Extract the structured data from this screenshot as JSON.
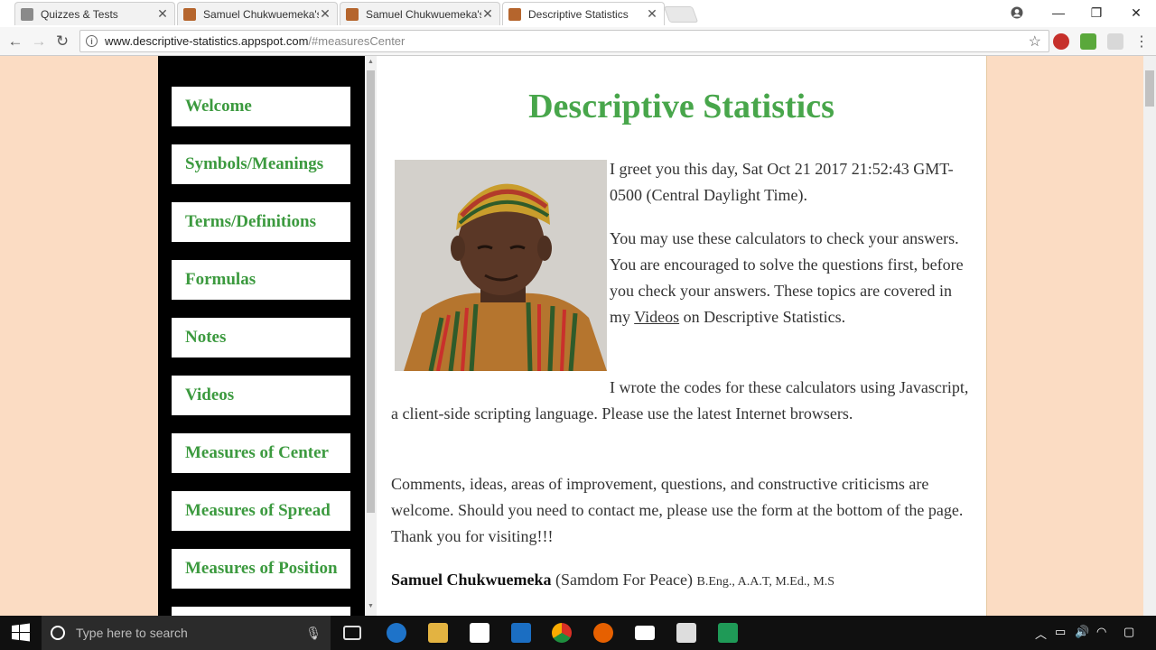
{
  "tabs": [
    {
      "label": "Quizzes & Tests",
      "favicon_color": "#7a7a7a"
    },
    {
      "label": "Samuel Chukwuemeka's",
      "favicon_color": "#b5652d"
    },
    {
      "label": "Samuel Chukwuemeka's",
      "favicon_color": "#b5652d"
    },
    {
      "label": "Descriptive Statistics",
      "favicon_color": "#b5652d"
    }
  ],
  "address": {
    "host": "www.descriptive-statistics.appspot.com",
    "path": "/#measuresCenter"
  },
  "sidebar": {
    "items": [
      {
        "label": "Welcome"
      },
      {
        "label": "Symbols/Meanings"
      },
      {
        "label": "Terms/Definitions"
      },
      {
        "label": "Formulas"
      },
      {
        "label": "Notes"
      },
      {
        "label": "Videos"
      },
      {
        "label": "Measures of Center"
      },
      {
        "label": "Measures of Spread"
      },
      {
        "label": "Measures of Position"
      }
    ]
  },
  "main": {
    "title": "Descriptive Statistics",
    "greeting": "I greet you this day, Sat Oct 21 2017 21:52:43 GMT-0500 (Central Daylight Time).",
    "para1_start": "You may use these calculators to check your answers. You are encouraged to solve the questions first, before you check your answers. These topics are covered in my ",
    "para1_link": "Videos",
    "para1_end": " on Descriptive Statistics.",
    "para2": "I wrote the codes for these calculators using Javascript, a client-side scripting language. Please use the latest Internet browsers.",
    "para3": "Comments, ideas, areas of improvement, questions, and constructive criticisms are welcome. Should you need to contact me, please use the form at the bottom of the page. Thank you for visiting!!!",
    "author_name": "Samuel Chukwuemeka",
    "author_alias": "(Samdom For Peace)",
    "author_degrees": "B.Eng., A.A.T, M.Ed., M.S"
  },
  "taskbar": {
    "search_placeholder": "Type here to search"
  },
  "colors": {
    "accent_green": "#48a64b",
    "page_bg": "#fbdcc3",
    "sidebar_bg": "#000000"
  }
}
